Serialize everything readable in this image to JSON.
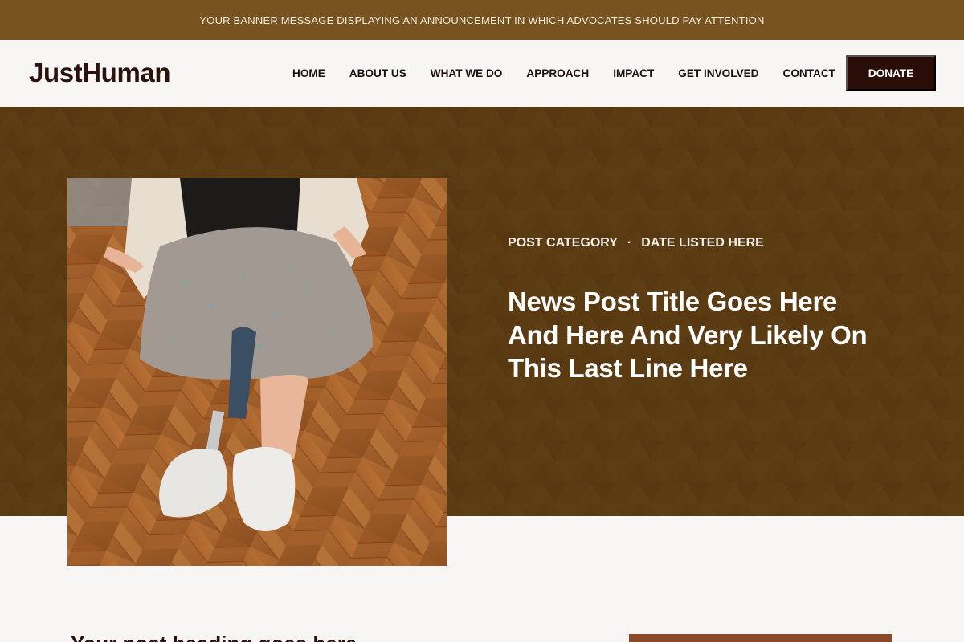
{
  "banner": {
    "message": "YOUR BANNER MESSAGE DISPLAYING AN ANNOUNCEMENT IN WHICH ADVOCATES SHOULD PAY ATTENTION"
  },
  "header": {
    "logo": "JustHuman",
    "nav": [
      "HOME",
      "ABOUT US",
      "WHAT WE DO",
      "APPROACH",
      "IMPACT",
      "GET INVOLVED",
      "CONTACT"
    ],
    "donate_label": "DONATE"
  },
  "hero": {
    "category": "POST CATEGORY",
    "separator": "·",
    "date": "DATE LISTED HERE",
    "title": "News Post Title Goes Here And Here And Very Likely On This Last Line Here"
  },
  "content": {
    "heading_partial": "Your post heading goes here"
  },
  "colors": {
    "banner_bg": "#76531f",
    "hero_bg": "#5a3b12",
    "donate_bg": "#2b0d08",
    "page_bg": "#f8f6f4"
  }
}
